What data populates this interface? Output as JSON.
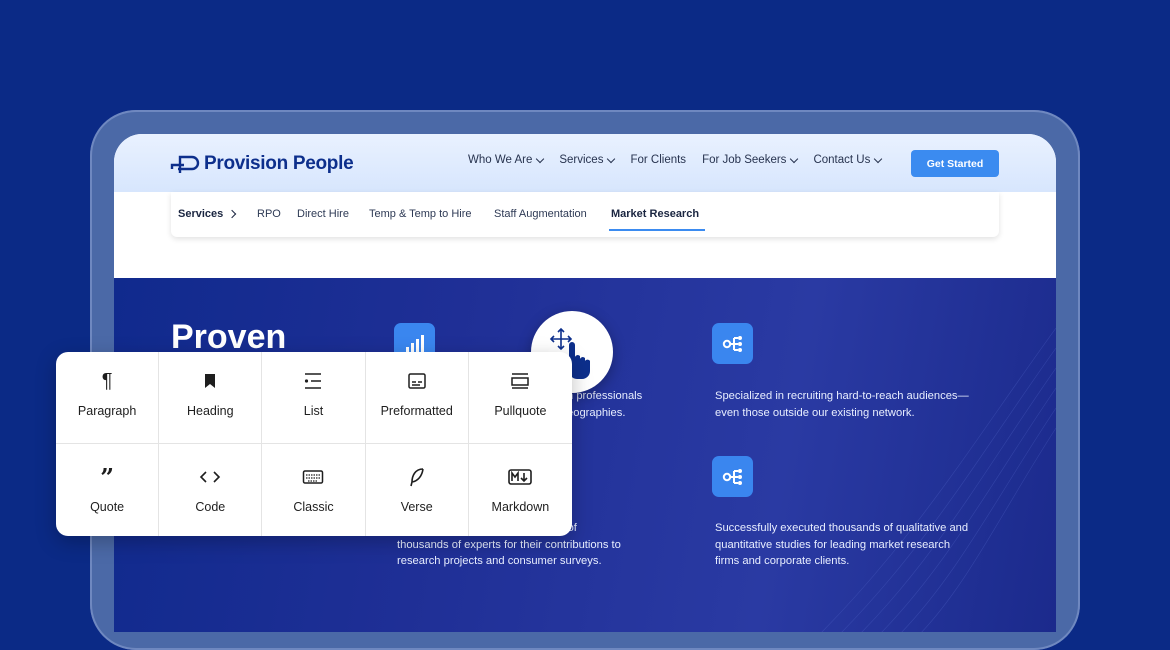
{
  "brand": {
    "name": "Provision People"
  },
  "nav": {
    "items": [
      {
        "label": "Who We Are",
        "dropdown": true
      },
      {
        "label": "Services",
        "dropdown": true
      },
      {
        "label": "For Clients",
        "dropdown": false
      },
      {
        "label": "For Job Seekers",
        "dropdown": true
      },
      {
        "label": "Contact Us",
        "dropdown": true
      }
    ],
    "cta": "Get Started"
  },
  "subnav": {
    "label": "Services",
    "items": [
      "RPO",
      "Direct Hire",
      "Temp & Temp to Hire",
      "Staff Augmentation",
      "Market Research"
    ],
    "active": "Market Research"
  },
  "hero": {
    "title": "Proven",
    "features": [
      {
        "icon": "chart-bars-icon",
        "text_line1": "n professionals",
        "text_line2": "eographies."
      },
      {
        "icon": "network-nodes-icon",
        "text_line1": "Specialized in recruiting hard-to-reach audiences—",
        "text_line2": "even those outside our existing network."
      },
      {
        "icon": "chart-bars-icon",
        "text_line1": "d tens of",
        "text_line2": "thousands of experts for their contributions to",
        "text_line3": "research projects and consumer surveys."
      },
      {
        "icon": "network-nodes-icon",
        "text_line1": "Successfully executed thousands of qualitative and",
        "text_line2": "quantitative studies for leading market research",
        "text_line3": "firms and corporate clients."
      }
    ]
  },
  "block_palette": {
    "items": [
      {
        "label": "Paragraph",
        "icon": "pilcrow-icon"
      },
      {
        "label": "Heading",
        "icon": "bookmark-icon"
      },
      {
        "label": "List",
        "icon": "list-icon"
      },
      {
        "label": "Preformatted",
        "icon": "preformatted-icon"
      },
      {
        "label": "Pullquote",
        "icon": "pullquote-icon"
      },
      {
        "label": "Quote",
        "icon": "quote-icon"
      },
      {
        "label": "Code",
        "icon": "code-icon"
      },
      {
        "label": "Classic",
        "icon": "keyboard-icon"
      },
      {
        "label": "Verse",
        "icon": "feather-icon"
      },
      {
        "label": "Markdown",
        "icon": "markdown-icon"
      }
    ]
  },
  "colors": {
    "background": "#0b2a86",
    "accent": "#3b8bf0",
    "brand": "#0d2f8c"
  }
}
